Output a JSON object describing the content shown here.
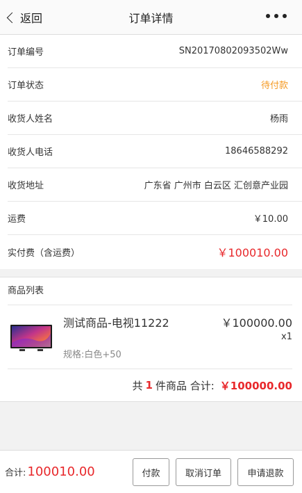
{
  "nav": {
    "back_label": "返回",
    "title": "订单详情"
  },
  "order_info": [
    {
      "key": "订单编号",
      "value": "SN20170802093502Ww"
    },
    {
      "key": "订单状态",
      "value": "待付款",
      "color": "#f59a23"
    },
    {
      "key": "收货人姓名",
      "value": "杨雨"
    },
    {
      "key": "收货人电话",
      "value": "18646588292"
    },
    {
      "key": "收货地址",
      "value": "广东省 广州市 白云区 汇创意产业园"
    },
    {
      "key": "运费",
      "value": "￥10.00"
    },
    {
      "key": "实付费（含运费）",
      "value": "￥100010.00",
      "color": "#e8282b"
    }
  ],
  "goods": {
    "header": "商品列表",
    "item": {
      "name": "测试商品-电视11222",
      "spec": "规格:白色+50",
      "price": "￥100000.00",
      "qty": "x1",
      "thumb_icon": "tv-icon"
    },
    "summary": {
      "prefix": "共",
      "count": "1",
      "suffix": "件商品 合计:",
      "amount": "￥100000.00"
    }
  },
  "bottom": {
    "total_label": "合计:",
    "total_value": "100010.00",
    "pay_label": "付款",
    "cancel_label": "取消订单",
    "refund_label": "申请退款"
  },
  "colors": {
    "accent_red": "#e8282b",
    "status_orange": "#f59a23"
  }
}
